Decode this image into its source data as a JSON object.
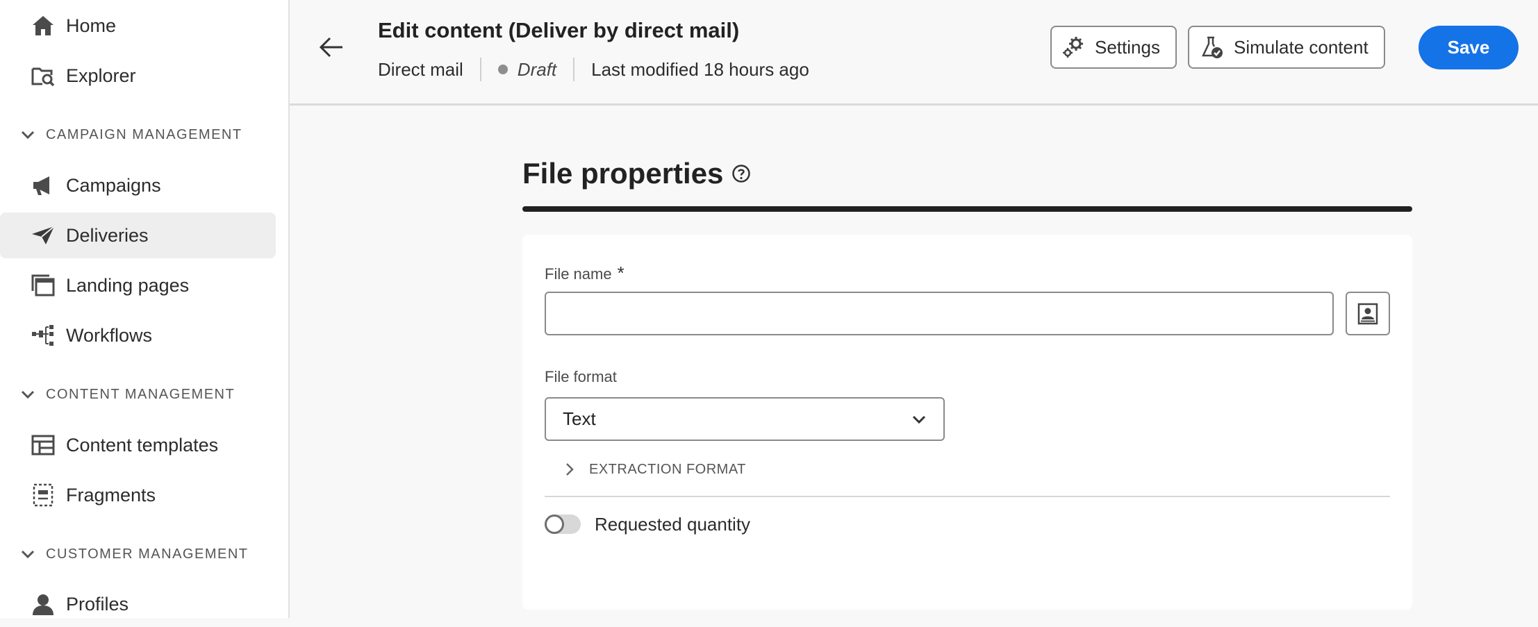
{
  "sidebar": {
    "items": [
      {
        "label": "Home",
        "icon": "home-icon"
      },
      {
        "label": "Explorer",
        "icon": "explorer-icon"
      },
      {
        "label": "Campaigns",
        "icon": "megaphone-icon"
      },
      {
        "label": "Deliveries",
        "icon": "paper-plane-icon",
        "selected": true
      },
      {
        "label": "Landing pages",
        "icon": "landing-pages-icon"
      },
      {
        "label": "Workflows",
        "icon": "workflow-icon"
      },
      {
        "label": "Content templates",
        "icon": "template-icon"
      },
      {
        "label": "Fragments",
        "icon": "fragments-icon"
      },
      {
        "label": "Profiles",
        "icon": "user-icon"
      }
    ],
    "sections": [
      {
        "label": "CAMPAIGN MANAGEMENT"
      },
      {
        "label": "CONTENT MANAGEMENT"
      },
      {
        "label": "CUSTOMER MANAGEMENT"
      }
    ]
  },
  "header": {
    "title": "Edit content (Deliver by direct mail)",
    "channel": "Direct mail",
    "status": "Draft",
    "last_modified": "Last modified 18 hours ago",
    "settings_label": "Settings",
    "simulate_label": "Simulate content",
    "save_label": "Save"
  },
  "main": {
    "heading": "File properties",
    "file_name": {
      "label": "File name",
      "required_mark": "*",
      "value": "",
      "placeholder": ""
    },
    "file_format": {
      "label": "File format",
      "selected": "Text"
    },
    "extraction_format_label": "EXTRACTION FORMAT",
    "requested_quantity": {
      "label": "Requested quantity",
      "enabled": false
    }
  },
  "colors": {
    "accent": "#1473e6",
    "selected_bg": "#eeeeee",
    "page_bg": "#f8f8f8"
  }
}
